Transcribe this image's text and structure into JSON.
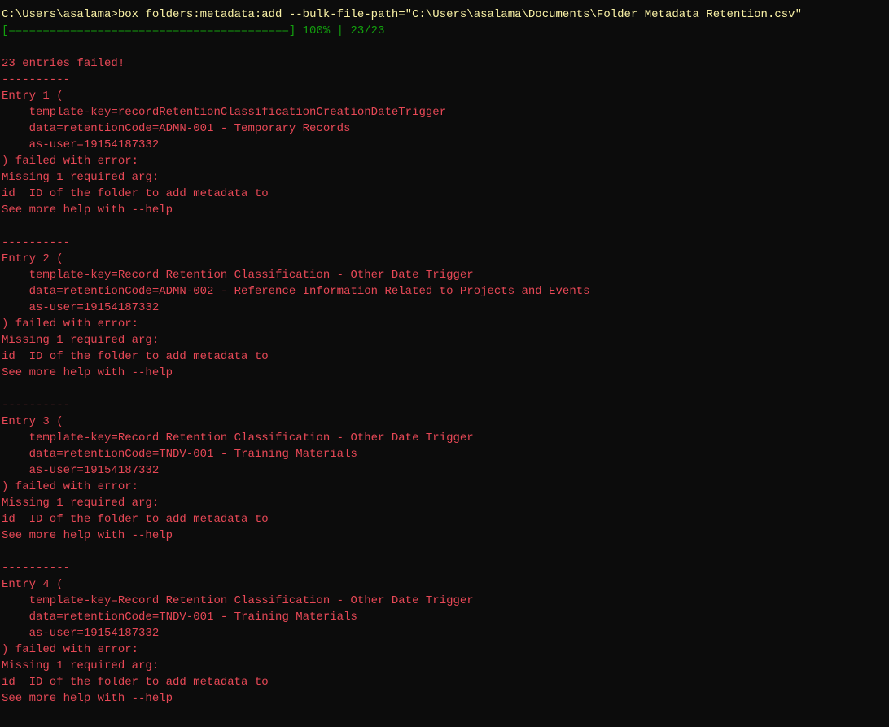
{
  "prompt": {
    "path": "C:\\Users\\asalama>",
    "command": "box folders:metadata:add --bulk-file-path=\"C:\\Users\\asalama\\Documents\\Folder Metadata Retention.csv\""
  },
  "progress": {
    "bar": "[=========================================]",
    "percent": "100%",
    "count": "23/23"
  },
  "summary": "23 entries failed!",
  "separator": "----------",
  "error_block": {
    "failed_with_error": ") failed with error:",
    "missing_arg": "Missing 1 required arg:",
    "id_desc": "id  ID of the folder to add metadata to",
    "see_help": "See more help with --help"
  },
  "entries": [
    {
      "header": "Entry 1 (",
      "template_key": "    template-key=recordRetentionClassificationCreationDateTrigger",
      "data": "    data=retentionCode=ADMN-001 - Temporary Records",
      "as_user": "    as-user=19154187332"
    },
    {
      "header": "Entry 2 (",
      "template_key": "    template-key=Record Retention Classification - Other Date Trigger",
      "data": "    data=retentionCode=ADMN-002 - Reference Information Related to Projects and Events",
      "as_user": "    as-user=19154187332"
    },
    {
      "header": "Entry 3 (",
      "template_key": "    template-key=Record Retention Classification - Other Date Trigger",
      "data": "    data=retentionCode=TNDV-001 - Training Materials",
      "as_user": "    as-user=19154187332"
    },
    {
      "header": "Entry 4 (",
      "template_key": "    template-key=Record Retention Classification - Other Date Trigger",
      "data": "    data=retentionCode=TNDV-001 - Training Materials",
      "as_user": "    as-user=19154187332"
    }
  ]
}
